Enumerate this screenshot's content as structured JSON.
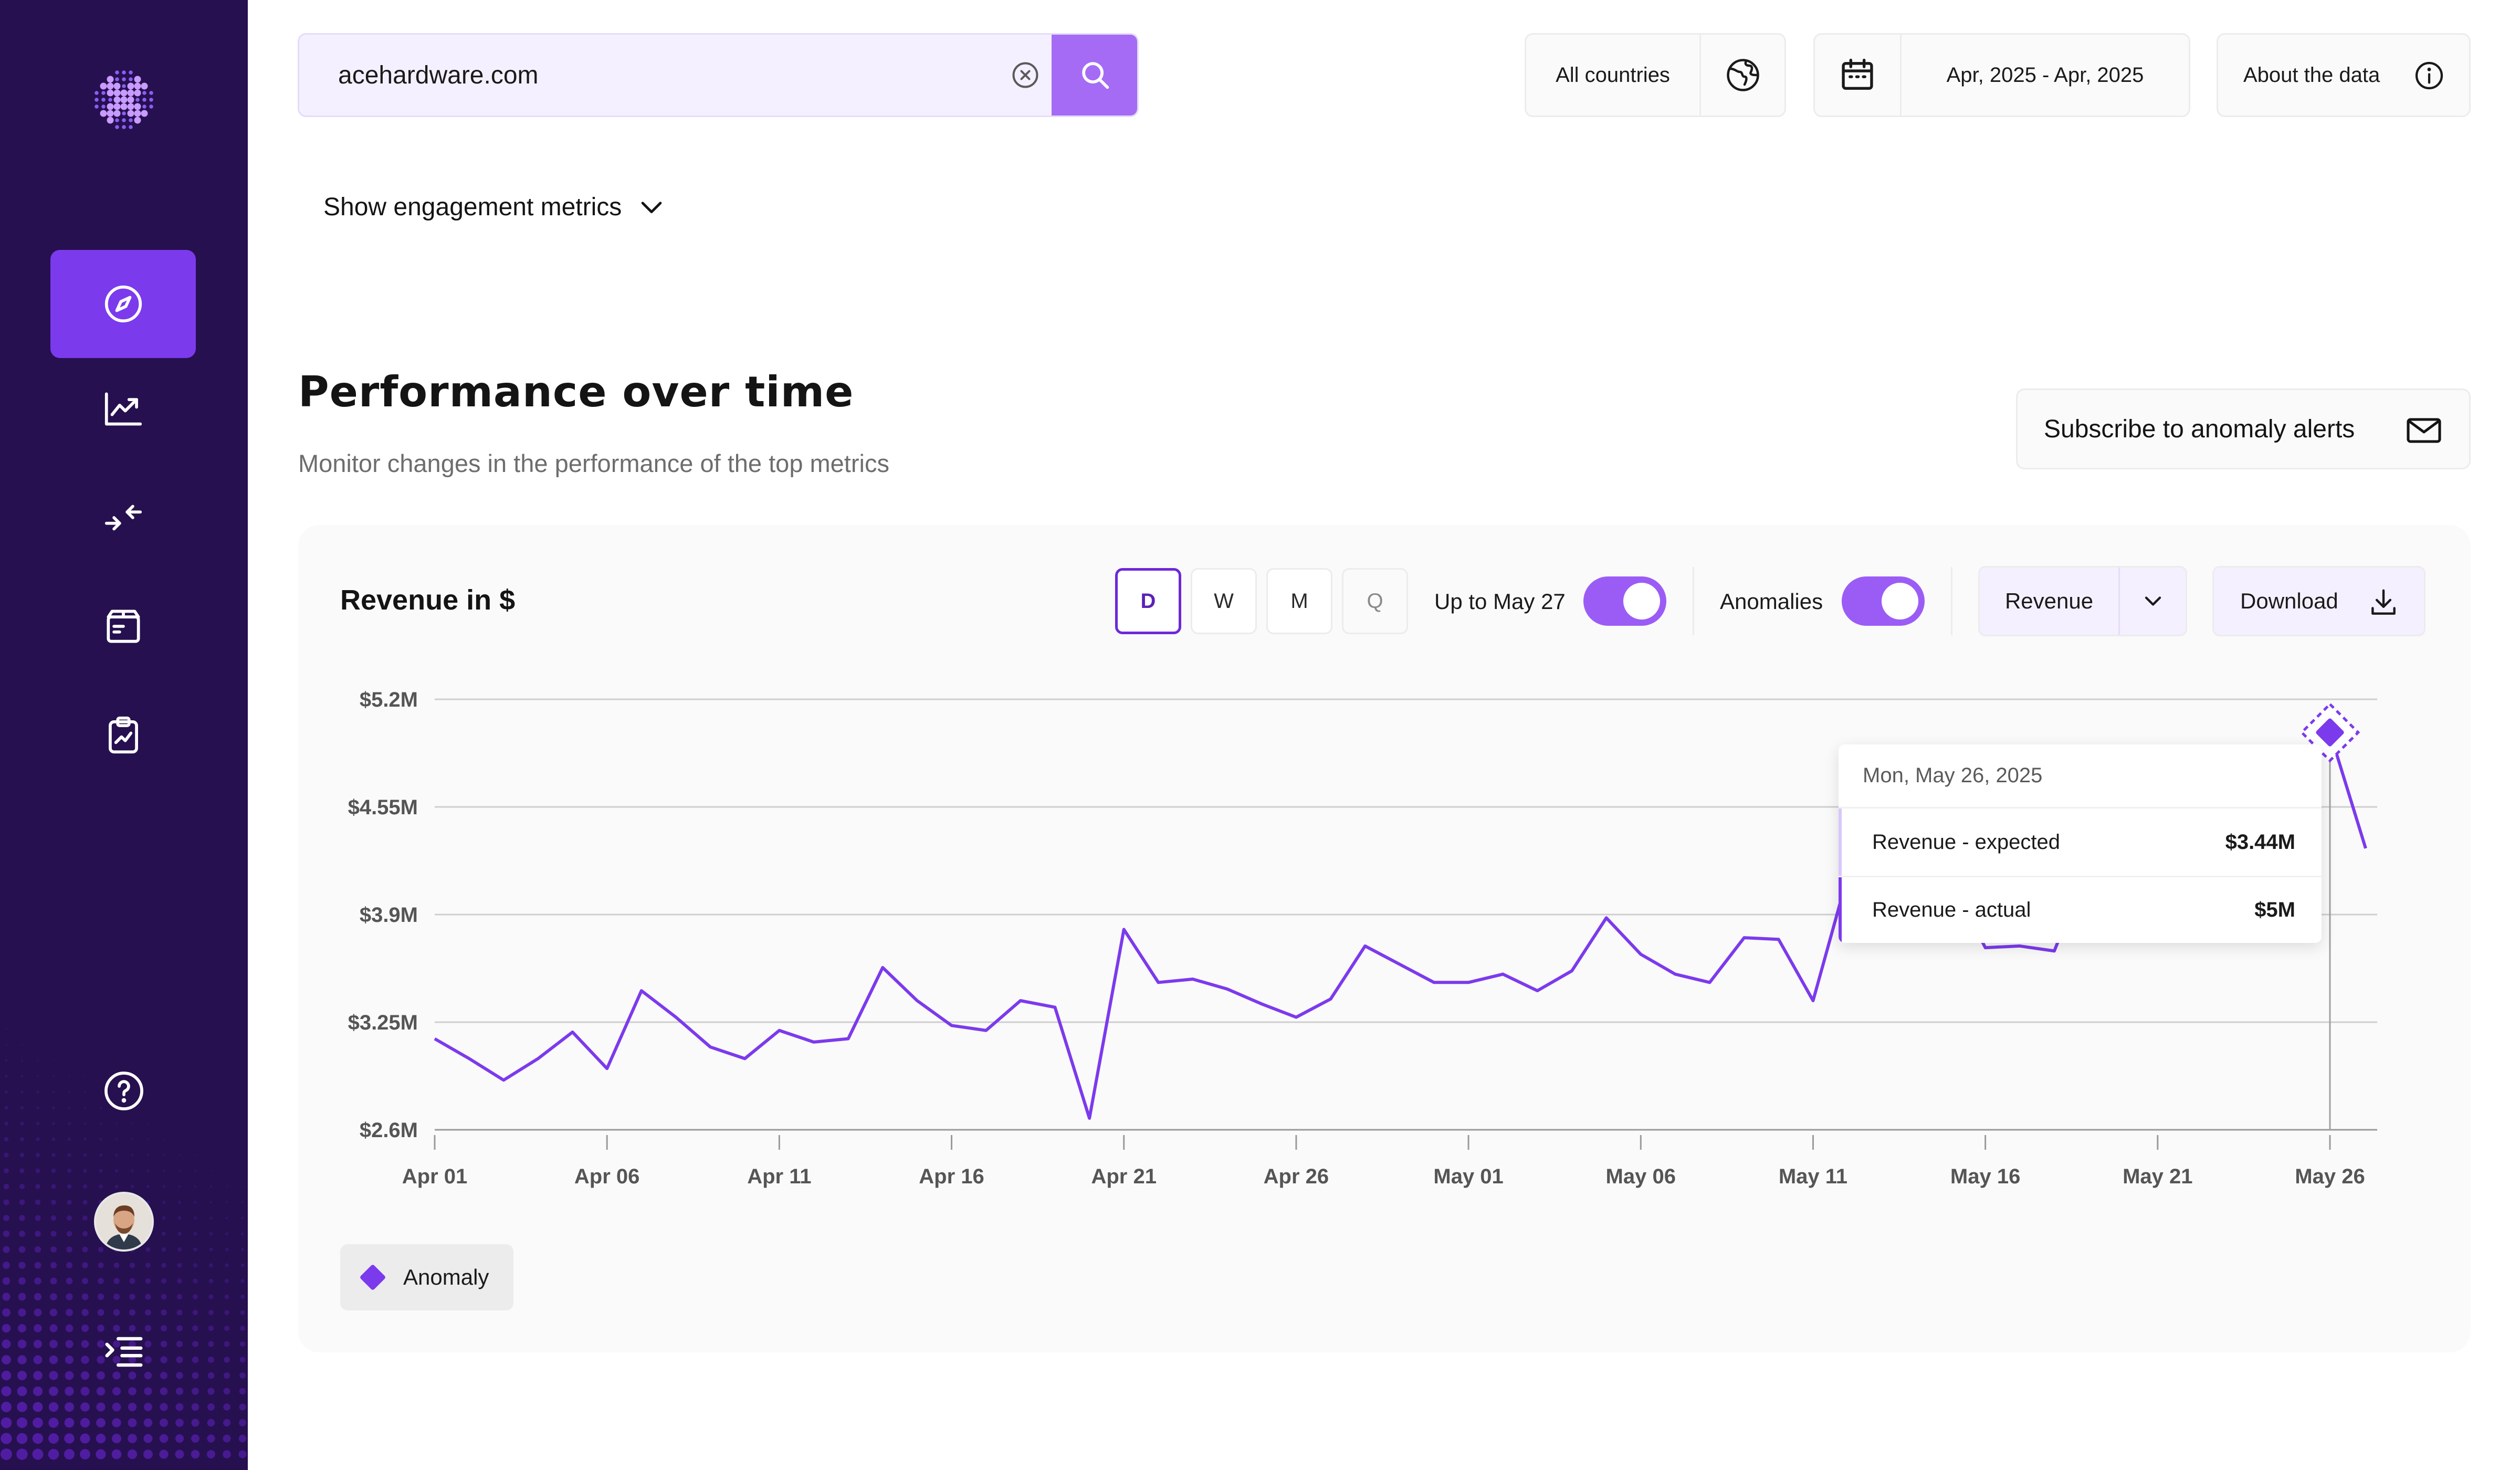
{
  "search": {
    "value": "acehardware.com",
    "placeholder": ""
  },
  "top": {
    "countries_label": "All countries",
    "date_range_label": "Apr, 2025 - Apr, 2025",
    "about_label": "About the data"
  },
  "engagement_toggle_label": "Show engagement metrics",
  "section": {
    "title": "Performance over time",
    "subtitle": "Monitor changes in the performance of the top metrics",
    "subscribe_label": "Subscribe to anomaly alerts"
  },
  "card": {
    "title": "Revenue in $",
    "periods": [
      "D",
      "W",
      "M",
      "Q"
    ],
    "active_period": "D",
    "up_to_label": "Up to May 27",
    "up_to_enabled": true,
    "anomalies_label": "Anomalies",
    "anomalies_enabled": true,
    "metric_select": "Revenue",
    "download_label": "Download",
    "legend_label": "Anomaly"
  },
  "tooltip": {
    "date": "Mon, May 26, 2025",
    "rows": [
      {
        "label": "Revenue - expected",
        "value": "$3.44M"
      },
      {
        "label": "Revenue - actual",
        "value": "$5M"
      }
    ]
  },
  "colors": {
    "sidebar": "#26104f",
    "accent": "#7c3aed",
    "line": "#7c3aed",
    "grid": "#cfcfcf"
  },
  "chart_data": {
    "type": "line",
    "title": "Revenue in $",
    "yticks": [
      "$2.6M",
      "$3.25M",
      "$3.9M",
      "$4.55M",
      "$5.2M"
    ],
    "ylim": [
      2.6,
      5.2
    ],
    "xticks": [
      "Apr 01",
      "Apr 06",
      "Apr 11",
      "Apr 16",
      "Apr 21",
      "Apr 26",
      "May 01",
      "May 06",
      "May 11",
      "May 16",
      "May 21",
      "May 26"
    ],
    "x": [
      "Apr 01",
      "Apr 02",
      "Apr 03",
      "Apr 04",
      "Apr 05",
      "Apr 06",
      "Apr 07",
      "Apr 08",
      "Apr 09",
      "Apr 10",
      "Apr 11",
      "Apr 12",
      "Apr 13",
      "Apr 14",
      "Apr 15",
      "Apr 16",
      "Apr 17",
      "Apr 18",
      "Apr 19",
      "Apr 20",
      "Apr 21",
      "Apr 22",
      "Apr 23",
      "Apr 24",
      "Apr 25",
      "Apr 26",
      "Apr 27",
      "Apr 28",
      "Apr 29",
      "Apr 30",
      "May 01",
      "May 02",
      "May 03",
      "May 04",
      "May 05",
      "May 06",
      "May 07",
      "May 08",
      "May 09",
      "May 10",
      "May 11",
      "May 12",
      "May 13",
      "May 14",
      "May 15",
      "May 16",
      "May 17",
      "May 18",
      "May 19",
      "May 20",
      "May 21",
      "May 22",
      "May 23",
      "May 24",
      "May 25",
      "May 26",
      "May 27"
    ],
    "series": [
      {
        "values": [
          3.15,
          3.03,
          2.9,
          3.03,
          3.19,
          2.97,
          3.44,
          3.28,
          3.1,
          3.03,
          3.2,
          3.13,
          3.15,
          3.58,
          3.38,
          3.23,
          3.2,
          3.38,
          3.34,
          2.67,
          3.81,
          3.49,
          3.51,
          3.45,
          3.36,
          3.28,
          3.39,
          3.71,
          3.6,
          3.49,
          3.49,
          3.54,
          3.44,
          3.56,
          3.88,
          3.66,
          3.54,
          3.49,
          3.76,
          3.75,
          3.38,
          4.13,
          4.15,
          4.12,
          4.1,
          3.7,
          3.71,
          3.68,
          4.2,
          4.25,
          4.3,
          4.32,
          4.4,
          4.45,
          4.65,
          5.0,
          4.3
        ],
        "visible_from": "Apr 01"
      }
    ],
    "anomalies": [
      {
        "x": "May 26",
        "value": 5.0
      }
    ],
    "hover_x": "May 26",
    "grid": true,
    "legend": "bottom-left"
  }
}
